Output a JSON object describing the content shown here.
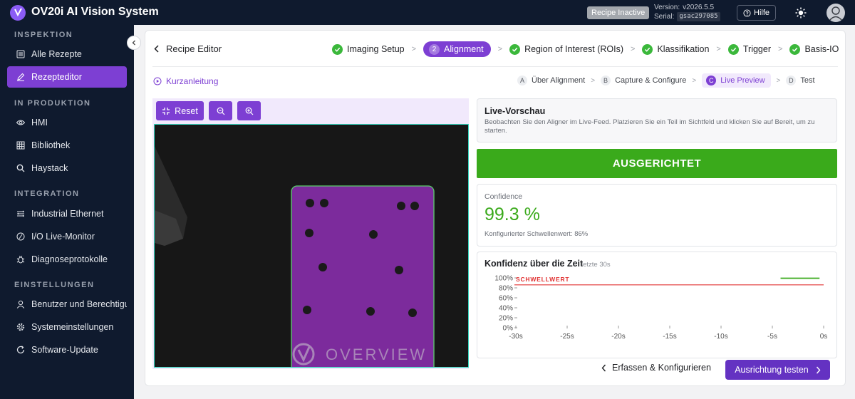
{
  "app": {
    "title": "OV20i AI Vision System",
    "badge": "Recipe Inactive",
    "version_label": "Version:",
    "version": "v2026.5.5",
    "serial_label": "Serial:",
    "serial": "gsac297085",
    "help_label": "Hilfe"
  },
  "sidebar": {
    "sections": [
      {
        "title": "INSPEKTION",
        "items": [
          {
            "label": "Alle Rezepte",
            "icon": "list-icon"
          },
          {
            "label": "Rezepteditor",
            "icon": "edit-icon",
            "active": true
          }
        ]
      },
      {
        "title": "IN PRODUKTION",
        "items": [
          {
            "label": "HMI",
            "icon": "eye-icon"
          },
          {
            "label": "Bibliothek",
            "icon": "grid-icon"
          },
          {
            "label": "Haystack",
            "icon": "search-icon"
          }
        ]
      },
      {
        "title": "INTEGRATION",
        "items": [
          {
            "label": "Industrial Ethernet",
            "icon": "network-icon"
          },
          {
            "label": "I/O Live-Monitor",
            "icon": "io-icon"
          },
          {
            "label": "Diagnoseprotokolle",
            "icon": "bug-icon"
          }
        ]
      },
      {
        "title": "EINSTELLUNGEN",
        "items": [
          {
            "label": "Benutzer und Berechtigungen",
            "icon": "user-icon"
          },
          {
            "label": "Systemeinstellungen",
            "icon": "gear-icon"
          },
          {
            "label": "Software-Update",
            "icon": "refresh-icon"
          }
        ]
      }
    ]
  },
  "editor": {
    "back_label": "Recipe Editor",
    "steps": [
      {
        "label": "Imaging Setup",
        "state": "done"
      },
      {
        "label": "Alignment",
        "state": "active",
        "num": "2"
      },
      {
        "label": "Region of Interest (ROIs)",
        "state": "done"
      },
      {
        "label": "Klassifikation",
        "state": "done"
      },
      {
        "label": "Trigger",
        "state": "done"
      },
      {
        "label": "Basis-IO",
        "state": "done"
      }
    ],
    "quick_guide": "Kurzanleitung",
    "substeps": [
      {
        "letter": "A",
        "label": "Über Alignment"
      },
      {
        "letter": "B",
        "label": "Capture & Configure"
      },
      {
        "letter": "C",
        "label": "Live Preview",
        "active": true
      },
      {
        "letter": "D",
        "label": "Test"
      }
    ]
  },
  "camera": {
    "reset_label": "Reset",
    "brand_text": "OVERVIEW"
  },
  "live": {
    "title": "Live-Vorschau",
    "description": "Beobachten Sie den Aligner im Live-Feed. Platzieren Sie ein Teil im Sichtfeld und klicken Sie auf Bereit, um zu starten.",
    "status": "AUSGERICHTET",
    "confidence_label": "Confidence",
    "confidence_value": "99.3 %",
    "threshold_text": "Konfigurierter Schwellenwert: 86%"
  },
  "chart_data": {
    "type": "line",
    "title": "Konfidenz über die Zeit",
    "subtitle": "letzte 30s",
    "threshold_label": "SCHWELLWERT",
    "threshold": 86,
    "x_ticks": [
      "-30s",
      "-25s",
      "-20s",
      "-15s",
      "-10s",
      "-5s",
      "0s"
    ],
    "y_ticks": [
      "100%",
      "80%",
      "60%",
      "40%",
      "20%",
      "0%"
    ],
    "xlim": [
      -30,
      0
    ],
    "ylim": [
      0,
      100
    ],
    "series": [
      {
        "x": [
          -4.2,
          -0.4
        ],
        "y": [
          99.3,
          99.3
        ]
      }
    ],
    "colors": {
      "threshold": "#e03030",
      "series": "#3aaa1b"
    }
  },
  "footer": {
    "back_label": "Erfassen & Konfigurieren",
    "next_label": "Ausrichtung testen"
  }
}
